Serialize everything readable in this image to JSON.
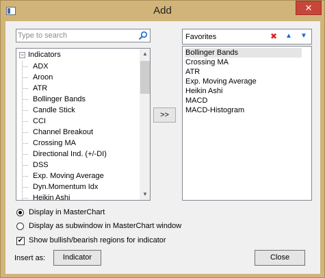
{
  "window": {
    "title": "Add",
    "close_glyph": "✕"
  },
  "search": {
    "placeholder": "Type to search",
    "value": ""
  },
  "tree": {
    "root_label": "Indicators",
    "root_expander": "−",
    "items": [
      "ADX",
      "Aroon",
      "ATR",
      "Bollinger Bands",
      "Candle Stick",
      "CCI",
      "Channel Breakout",
      "Crossing MA",
      "Directional Ind. (+/-DI)",
      "DSS",
      "Exp. Moving Average",
      "Dyn.Momentum Idx",
      "Heikin Ashi"
    ]
  },
  "add_button": {
    "label": ">>"
  },
  "favorites": {
    "title": "Favorites",
    "items": [
      "Bollinger Bands",
      "Crossing MA",
      "ATR",
      "Exp. Moving Average",
      "Heikin Ashi",
      "MACD",
      "MACD-Histogram"
    ],
    "selected_index": 0,
    "tools": {
      "delete_glyph": "✖",
      "up_glyph": "▲",
      "down_glyph": "▼"
    }
  },
  "options": {
    "display_masterchart": "Display in MasterChart",
    "display_subwindow": "Display as subwindow in MasterChart window",
    "show_regions": "Show bullish/bearish regions for indicator",
    "selected_display": "masterchart",
    "show_regions_checked": true,
    "check_glyph": "✔"
  },
  "insert": {
    "label": "Insert as:",
    "button_label": "Indicator"
  },
  "close_button": {
    "label": "Close"
  },
  "colors": {
    "title_bar": "#d1b47a",
    "close_button": "#c7463a",
    "delete_icon": "#e02020",
    "arrow_icons": "#1e66d0"
  }
}
